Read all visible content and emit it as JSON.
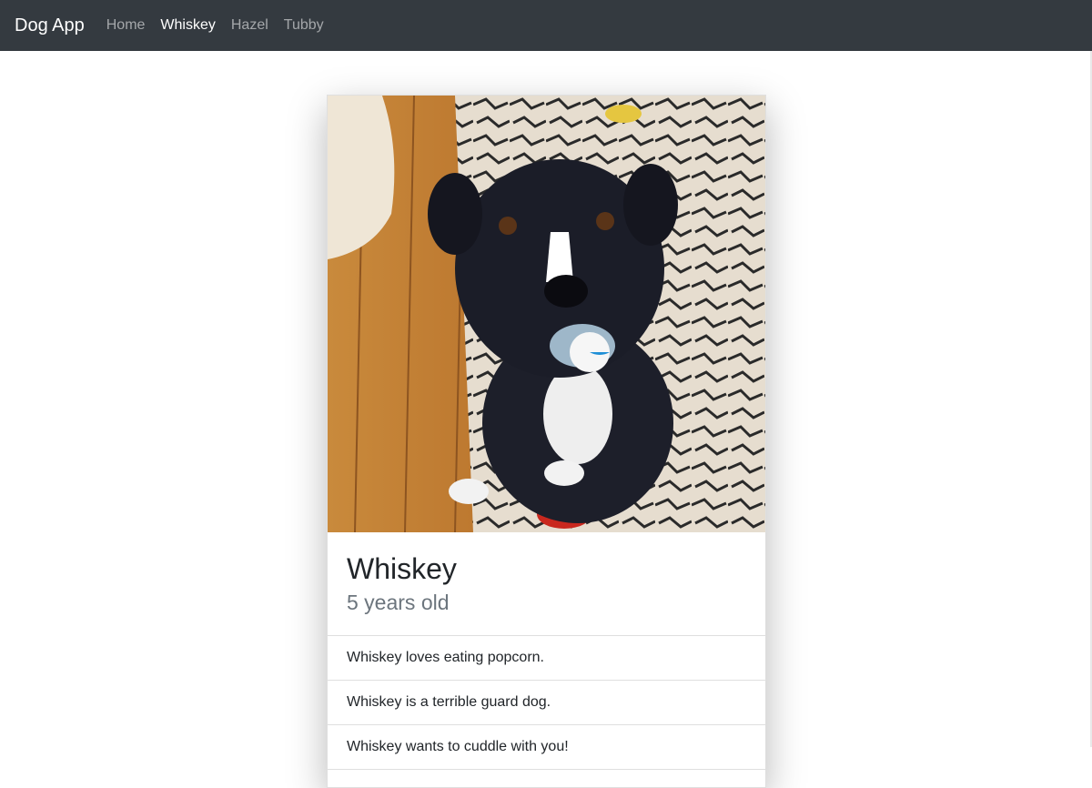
{
  "navbar": {
    "brand": "Dog App",
    "links": [
      {
        "label": "Home",
        "active": false
      },
      {
        "label": "Whiskey",
        "active": true
      },
      {
        "label": "Hazel",
        "active": false
      },
      {
        "label": "Tubby",
        "active": false
      }
    ],
    "background": "#343a40"
  },
  "dog": {
    "name": "Whiskey",
    "age": "5 years old",
    "facts": [
      "Whiskey loves eating popcorn.",
      "Whiskey is a terrible guard dog.",
      "Whiskey wants to cuddle with you!"
    ]
  },
  "colors": {
    "heading": "#212529",
    "muted": "#6c757d"
  }
}
